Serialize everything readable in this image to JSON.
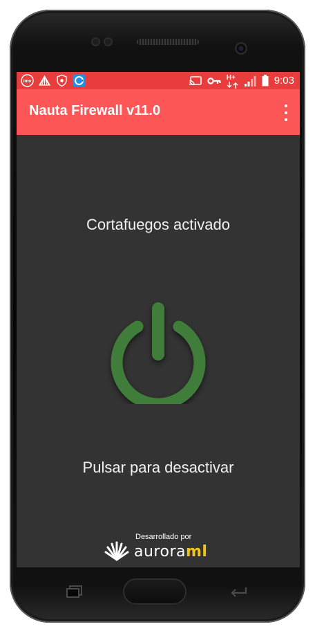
{
  "status_bar": {
    "time": "9:03",
    "network_type": "H+",
    "left_icons": [
      "imo-icon",
      "shell-logo-icon",
      "shield-icon",
      "browser-app-icon"
    ],
    "right_icons": [
      "cast-icon",
      "vpn-key-icon",
      "network-activity-icon",
      "signal-icon",
      "battery-icon"
    ],
    "imo_label": "imo"
  },
  "app_bar": {
    "title": "Nauta Firewall v11.0",
    "menu_icon": "overflow-menu-icon"
  },
  "main": {
    "status_text": "Cortafuegos activado",
    "power_icon": "power-icon",
    "action_text": "Pulsar para desactivar"
  },
  "footer": {
    "credit_label": "Desarrollado por",
    "brand_part1": "aurora",
    "brand_part2": "ml"
  },
  "colors": {
    "status_bar": "#e83d3d",
    "app_bar": "#fd5656",
    "background": "#333333",
    "power_green": "#3f7d3a",
    "brand_accent": "#f0c419"
  }
}
